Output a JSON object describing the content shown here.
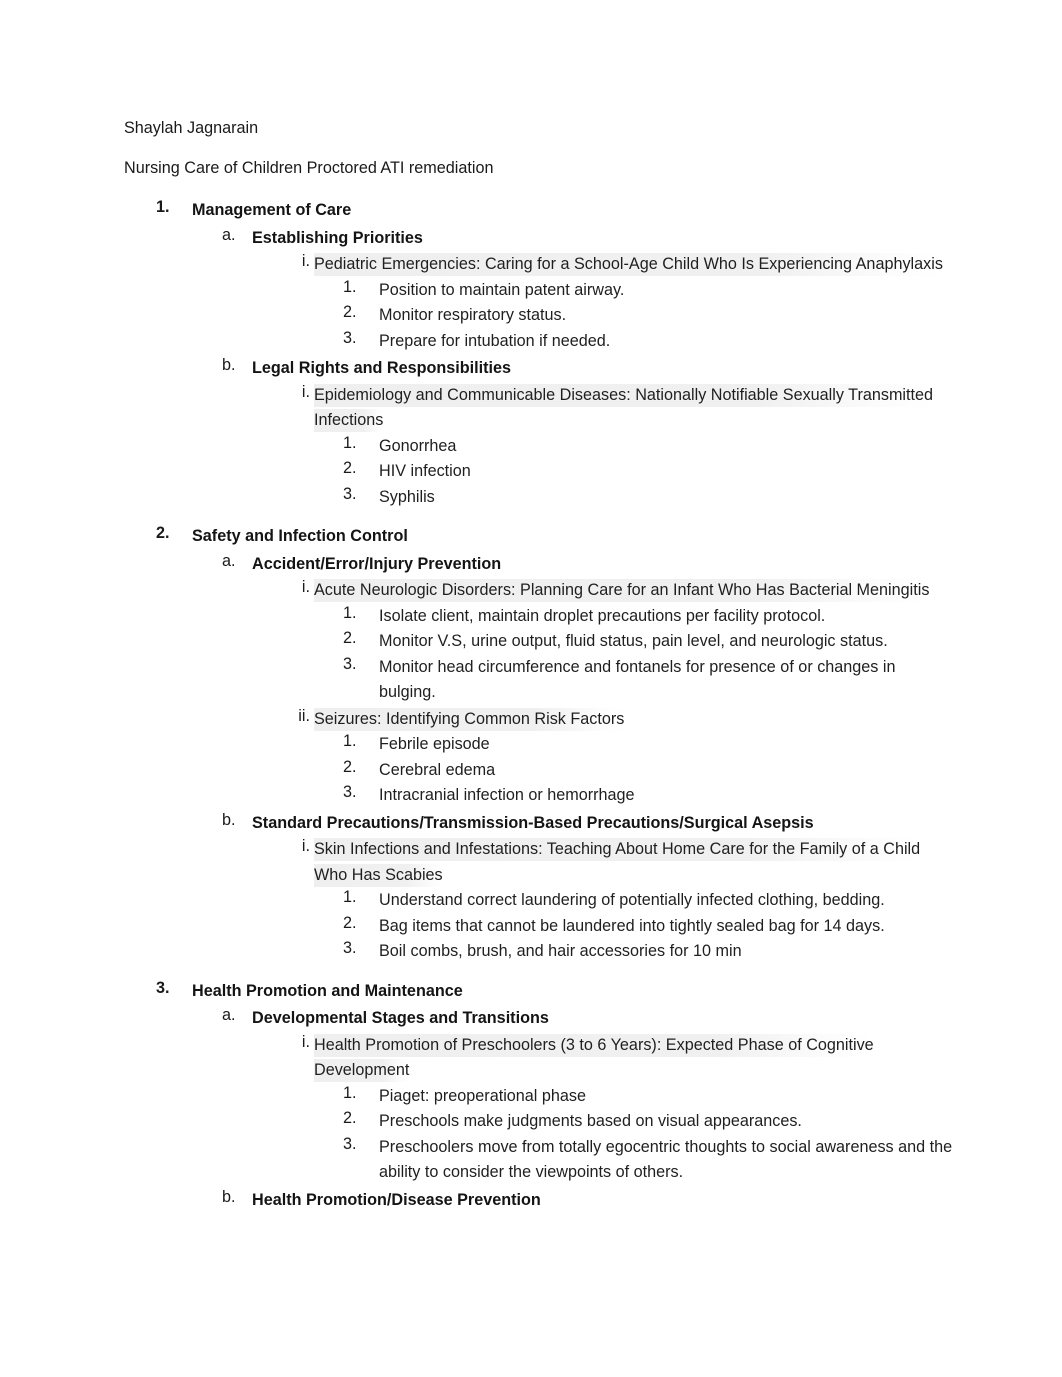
{
  "document": {
    "author": "Shaylah Jagnarain",
    "subtitle": "Nursing Care of Children Proctored ATI remediation",
    "highlight_color": "#eeeeee",
    "text_color": "#1a1a1a",
    "page_background": "#ffffff"
  },
  "outline": [
    {
      "marker": "1.",
      "label": "Management of Care",
      "children": [
        {
          "marker": "a.",
          "label": "Establishing Priorities",
          "children": [
            {
              "marker": "i.",
              "label": "Pediatric Emergencies: Caring for a School-Age Child Who Is Experiencing Anaphylaxis",
              "children": [
                {
                  "marker": "1.",
                  "label": "Position to maintain patent airway."
                },
                {
                  "marker": "2.",
                  "label": "Monitor respiratory status."
                },
                {
                  "marker": "3.",
                  "label": "Prepare for intubation if needed."
                }
              ]
            }
          ]
        },
        {
          "marker": "b.",
          "label": "Legal Rights and Responsibilities",
          "children": [
            {
              "marker": "i.",
              "label": "Epidemiology and Communicable Diseases: Nationally Notifiable Sexually Transmitted Infections",
              "children": [
                {
                  "marker": "1.",
                  "label": "Gonorrhea"
                },
                {
                  "marker": "2.",
                  "label": "HIV infection"
                },
                {
                  "marker": "3.",
                  "label": "Syphilis"
                }
              ]
            }
          ]
        }
      ]
    },
    {
      "marker": "2.",
      "label": "Safety and Infection Control",
      "children": [
        {
          "marker": "a.",
          "label": "Accident/Error/Injury Prevention",
          "children": [
            {
              "marker": "i.",
              "label": "Acute Neurologic Disorders: Planning Care for an Infant Who Has Bacterial Meningitis",
              "children": [
                {
                  "marker": "1.",
                  "label": "Isolate client, maintain droplet precautions per facility protocol."
                },
                {
                  "marker": "2.",
                  "label": "Monitor V.S, urine output, fluid status, pain level, and neurologic status."
                },
                {
                  "marker": "3.",
                  "label": "Monitor head circumference and fontanels for presence of or changes in bulging."
                }
              ]
            },
            {
              "marker": "ii.",
              "label": "Seizures: Identifying Common Risk Factors",
              "children": [
                {
                  "marker": "1.",
                  "label": "Febrile episode"
                },
                {
                  "marker": "2.",
                  "label": "Cerebral edema"
                },
                {
                  "marker": "3.",
                  "label": "Intracranial infection or hemorrhage"
                }
              ]
            }
          ]
        },
        {
          "marker": "b.",
          "label": "Standard Precautions/Transmission-Based Precautions/Surgical Asepsis",
          "children": [
            {
              "marker": "i.",
              "label": "Skin Infections and Infestations: Teaching About Home Care for the Family of a Child Who Has Scabies",
              "children": [
                {
                  "marker": "1.",
                  "label": "Understand correct laundering of potentially infected clothing, bedding."
                },
                {
                  "marker": "2.",
                  "label": "Bag items that cannot be laundered into tightly sealed bag for 14 days."
                },
                {
                  "marker": "3.",
                  "label": "Boil combs, brush, and hair accessories for 10 min"
                }
              ]
            }
          ]
        }
      ]
    },
    {
      "marker": "3.",
      "label": "Health Promotion and Maintenance",
      "children": [
        {
          "marker": "a.",
          "label": "Developmental Stages and Transitions",
          "children": [
            {
              "marker": "i.",
              "label": "Health Promotion of Preschoolers (3 to 6 Years): Expected Phase of Cognitive Development",
              "children": [
                {
                  "marker": "1.",
                  "label": "Piaget: preoperational phase"
                },
                {
                  "marker": "2.",
                  "label": "Preschools make judgments based on visual appearances."
                },
                {
                  "marker": "3.",
                  "label": "Preschoolers move from totally egocentric thoughts to social awareness and the ability to consider the viewpoints of others."
                }
              ]
            }
          ]
        },
        {
          "marker": "b.",
          "label": "Health Promotion/Disease Prevention",
          "children": []
        }
      ]
    }
  ]
}
